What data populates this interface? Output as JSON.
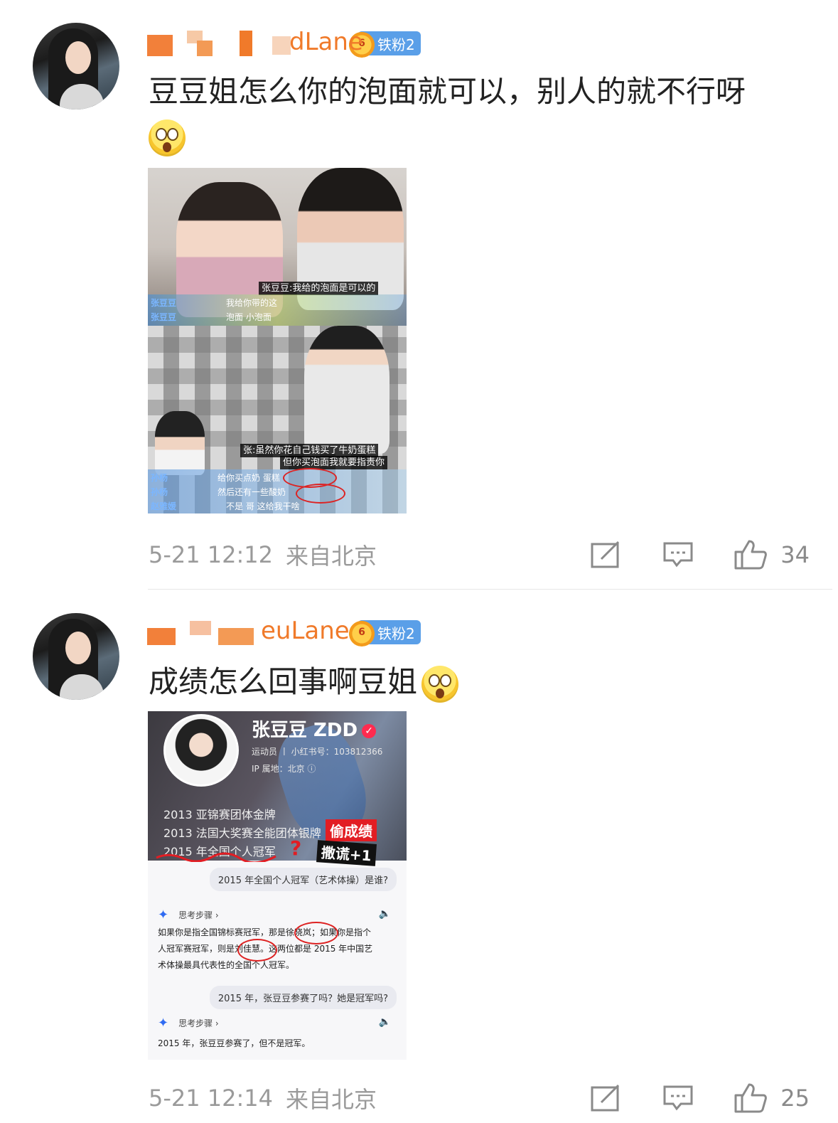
{
  "comments": [
    {
      "username_visible": "dLane",
      "badge": {
        "level_label": "铁粉2",
        "crown_level": "6"
      },
      "text": "豆豆姐怎么你的泡面就可以，别人的就不行呀",
      "emoji": "astonished-emoji",
      "image": {
        "caption_top": "张豆豆:我给的泡面是可以的",
        "danmu_top": [
          {
            "who": "张豆豆",
            "text": "我给你带的这"
          },
          {
            "who": "张豆豆",
            "text": "泡面 小泡面"
          }
        ],
        "caption_bottom_1": "张:虽然你花自己钱买了牛奶蛋糕",
        "caption_bottom_2": "但你买泡面我就要指责你",
        "danmu_bottom": [
          {
            "who": "孙杨",
            "text": "给你买点奶 蛋糕"
          },
          {
            "who": "孙杨",
            "text": "然后还有一些酸奶"
          },
          {
            "who": "赵雅媛",
            "text": "不是 哥 这给我干啥"
          }
        ]
      },
      "time": "5-21 12:12",
      "location": "来自北京",
      "likes": "34"
    },
    {
      "username_visible": "euLane",
      "badge": {
        "level_label": "铁粉2",
        "crown_level": "6"
      },
      "text": "成绩怎么回事啊豆姐",
      "emoji": "astonished-emoji",
      "image": {
        "profile_name": "张豆豆 ZDD",
        "profile_role": "运动员 丨 小红书号：103812366",
        "profile_ip": "IP 属地：北京 ⓘ",
        "achievements": [
          "2013 亚锦赛团体金牌",
          "2013 法国大奖赛全能团体银牌",
          "2015 年全国个人冠军"
        ],
        "tag_red": "偷成绩",
        "tag_black": "撒谎+1",
        "question_mark": "?",
        "q1": "2015 年全国个人冠军（艺术体操）是谁?",
        "think_label": "思考步骤 ›",
        "answer1_lines": [
          "如果你是指全国锦标赛冠军，那是徐晓岚；如果你是指个",
          "人冠军赛冠军，则是刘佳慧。这两位都是 2015 年中国艺",
          "术体操最具代表性的全国个人冠军。"
        ],
        "q2": "2015 年，张豆豆参赛了吗？她是冠军吗?",
        "answer2": "2015 年，张豆豆参赛了，但不是冠军。"
      },
      "time": "5-21 12:14",
      "location": "来自北京",
      "likes": "25"
    }
  ],
  "colors": {
    "username": "#f07a2a",
    "badge_bg": "#5a9fe8",
    "meta_text": "#9a9a9a",
    "accent_red": "#e21d23"
  },
  "icons": [
    "share-icon",
    "comment-icon",
    "like-icon"
  ]
}
